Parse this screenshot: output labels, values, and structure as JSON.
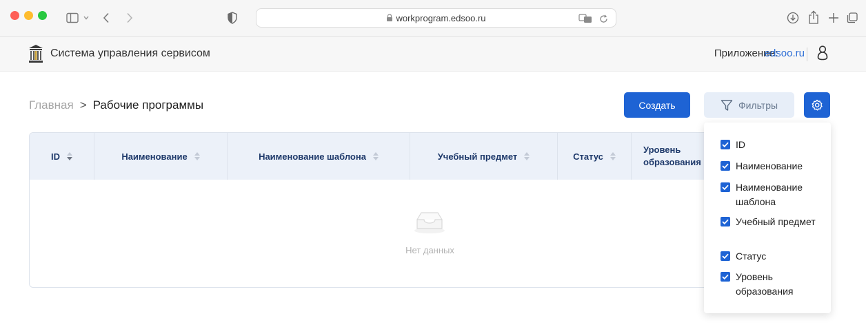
{
  "browser": {
    "url": "workprogram.edsoo.ru"
  },
  "app": {
    "title": "Система управления сервисом",
    "app_label": "Приложение:",
    "app_link": "edsoo.ru"
  },
  "breadcrumb": {
    "home": "Главная",
    "separator": ">",
    "current": "Рабочие программы"
  },
  "toolbar": {
    "create_label": "Создать",
    "filters_label": "Фильтры"
  },
  "table": {
    "columns": [
      {
        "label": "ID"
      },
      {
        "label": "Наименование"
      },
      {
        "label": "Наименование шаблона"
      },
      {
        "label": "Учебный предмет"
      },
      {
        "label": "Статус"
      },
      {
        "label": "Уровень образования"
      }
    ],
    "empty_text": "Нет данных"
  },
  "column_settings": {
    "options": [
      {
        "label": "ID",
        "checked": true
      },
      {
        "label": "Наименование",
        "checked": true
      },
      {
        "label": "Наименование шаблона",
        "checked": true
      },
      {
        "label": "Учебный предмет",
        "checked": true
      },
      {
        "label": "Статус",
        "checked": true
      },
      {
        "label": "Уровень образования",
        "checked": true
      }
    ]
  },
  "colors": {
    "primary": "#1e63d4",
    "header_bg": "#ecf1f9",
    "link": "#2f6fd6"
  }
}
